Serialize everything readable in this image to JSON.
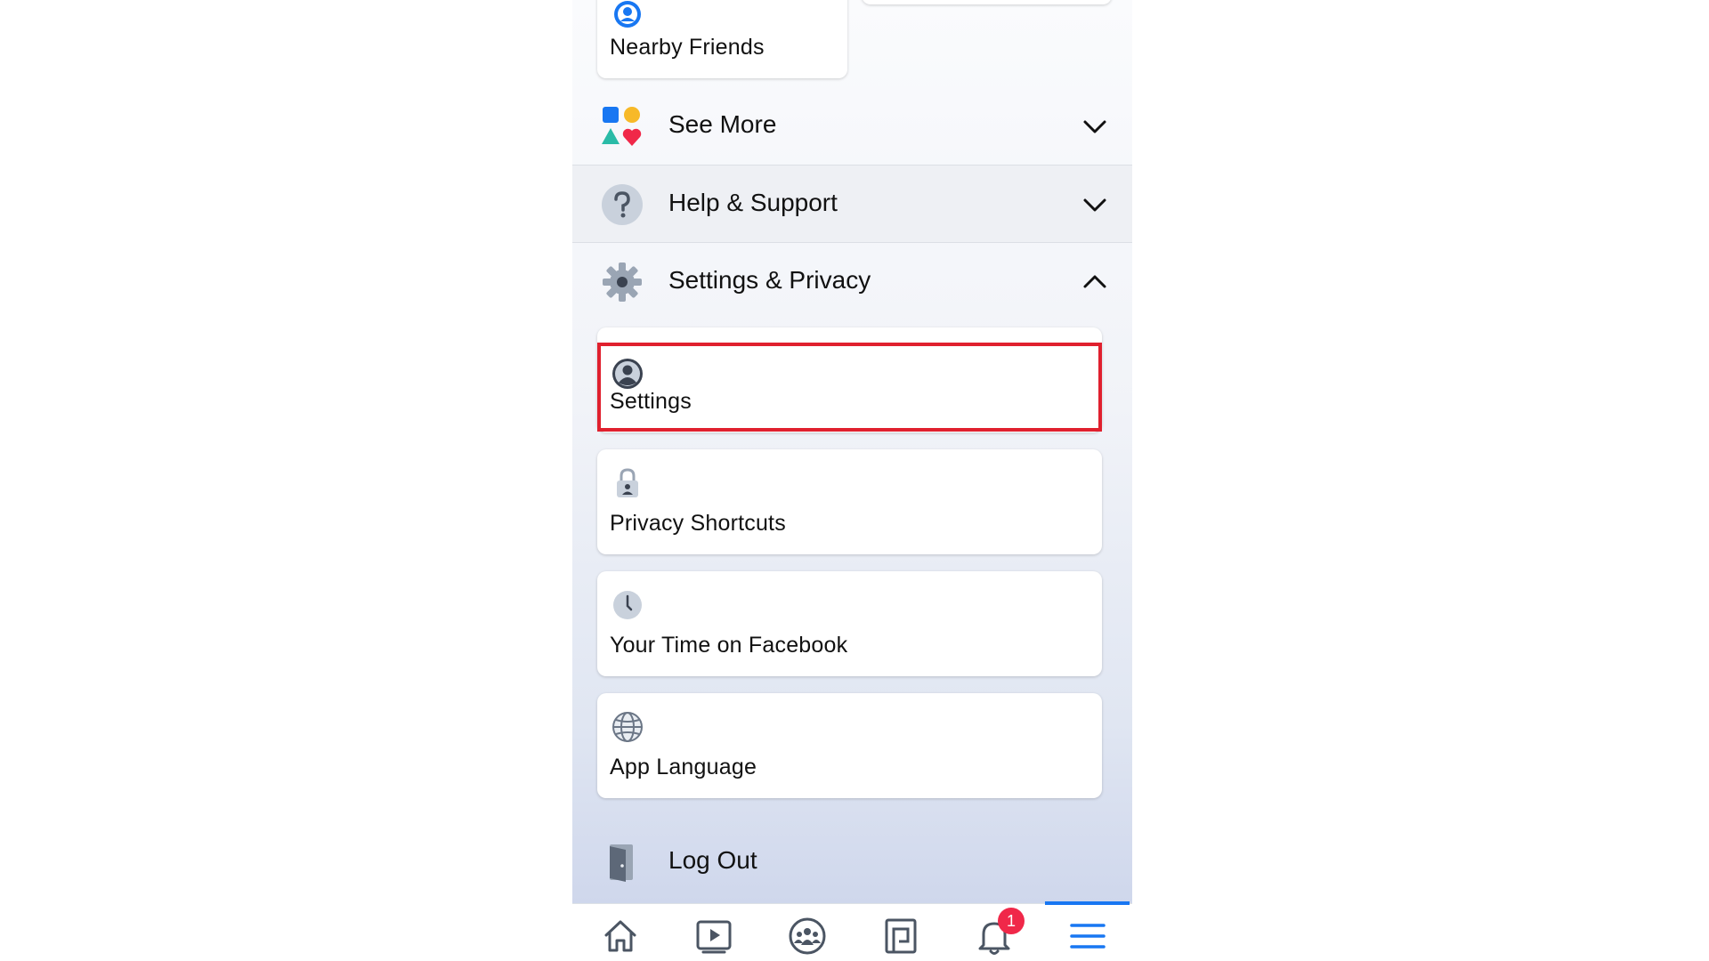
{
  "top_cards": {
    "nearby_friends_label": "Nearby Friends"
  },
  "sections": {
    "see_more": {
      "title": "See More",
      "icon": "shapes-icon",
      "expanded": false
    },
    "help_support": {
      "title": "Help & Support",
      "icon": "question-icon",
      "expanded": false
    },
    "settings_privacy": {
      "title": "Settings & Privacy",
      "icon": "gear-icon",
      "expanded": true
    }
  },
  "settings_privacy_items": [
    {
      "label": "Settings",
      "icon": "profile-icon",
      "highlighted": true
    },
    {
      "label": "Privacy Shortcuts",
      "icon": "lock-icon"
    },
    {
      "label": "Your Time on Facebook",
      "icon": "clock-icon"
    },
    {
      "label": "App Language",
      "icon": "globe-icon"
    }
  ],
  "logout": {
    "label": "Log Out",
    "icon": "door-icon"
  },
  "tab_bar": {
    "tabs": [
      "home-icon",
      "watch-icon",
      "groups-icon",
      "pages-icon",
      "notifications-icon",
      "menu-icon"
    ],
    "active": "menu-icon",
    "notification_badge": "1"
  },
  "colors": {
    "accent": "#1877f2",
    "highlight_border": "#e0202e",
    "badge": "#f02849"
  }
}
